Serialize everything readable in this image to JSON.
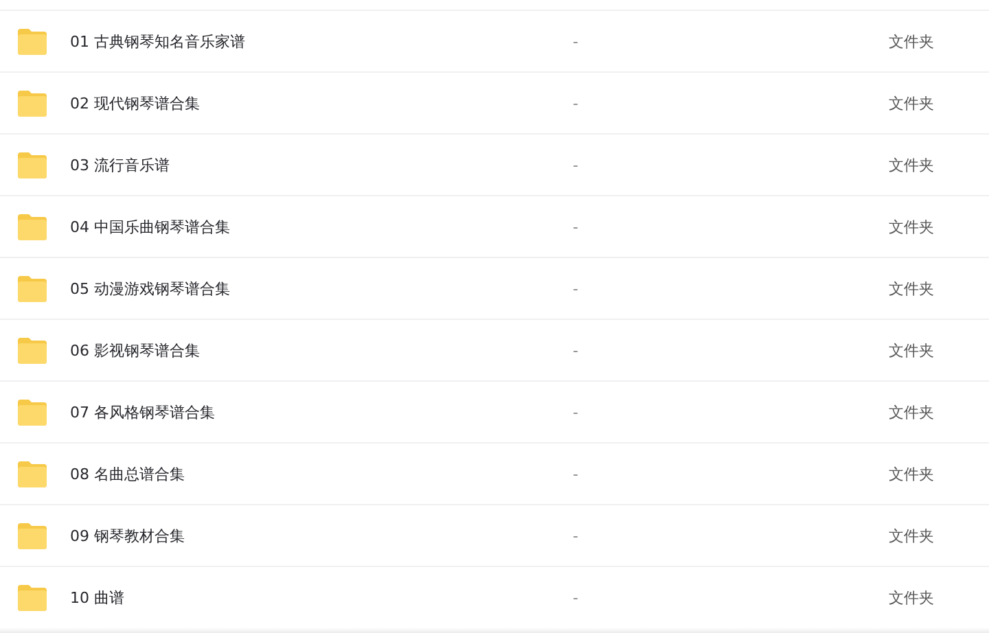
{
  "files": [
    {
      "name": "01 古典钢琴知名音乐家谱",
      "size": "-",
      "type": "文件夹"
    },
    {
      "name": "02 现代钢琴谱合集",
      "size": "-",
      "type": "文件夹"
    },
    {
      "name": "03 流行音乐谱",
      "size": "-",
      "type": "文件夹"
    },
    {
      "name": "04 中国乐曲钢琴谱合集",
      "size": "-",
      "type": "文件夹"
    },
    {
      "name": "05 动漫游戏钢琴谱合集",
      "size": "-",
      "type": "文件夹"
    },
    {
      "name": "06 影视钢琴谱合集",
      "size": "-",
      "type": "文件夹"
    },
    {
      "name": "07 各风格钢琴谱合集",
      "size": "-",
      "type": "文件夹"
    },
    {
      "name": "08 名曲总谱合集",
      "size": "-",
      "type": "文件夹"
    },
    {
      "name": "09 钢琴教材合集",
      "size": "-",
      "type": "文件夹"
    },
    {
      "name": "10 曲谱",
      "size": "-",
      "type": "文件夹"
    }
  ]
}
